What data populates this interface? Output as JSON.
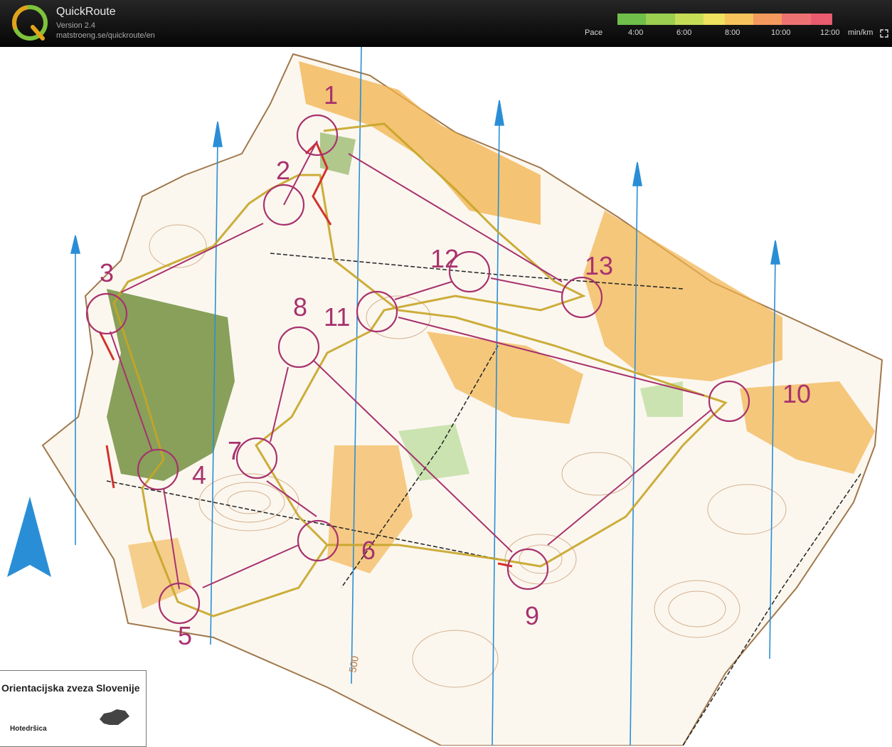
{
  "app": {
    "name": "QuickRoute",
    "version": "Version 2.4",
    "url": "matstroeng.se/quickroute/en",
    "logo_letter": "Q"
  },
  "pace": {
    "label": "Pace",
    "ticks": [
      "4:00",
      "6:00",
      "8:00",
      "10:00",
      "12:00"
    ],
    "unit": "min/km",
    "scale_colors": [
      "#6fbf4a",
      "#9bcf50",
      "#c6dd56",
      "#eee25e",
      "#f6c35c",
      "#f59a5e",
      "#ef7272",
      "#e95b6e"
    ]
  },
  "map": {
    "controls": [
      {
        "label": "1"
      },
      {
        "label": "2"
      },
      {
        "label": "3"
      },
      {
        "label": "4"
      },
      {
        "label": "5"
      },
      {
        "label": "6"
      },
      {
        "label": "7"
      },
      {
        "label": "8"
      },
      {
        "label": "9"
      },
      {
        "label": "10"
      },
      {
        "label": "11"
      },
      {
        "label": "12"
      },
      {
        "label": "13"
      }
    ],
    "contour_label": "500",
    "colors": {
      "course": "#a8326e",
      "magnetic_north": "#2a8ed6",
      "forest": "#6b8a35",
      "open": "#f2b24a",
      "contour": "#b8763e",
      "route": "#c7a426"
    }
  },
  "legend": {
    "federation": "Orientacijska zveza Slovenije",
    "place": "Hotedršica"
  }
}
